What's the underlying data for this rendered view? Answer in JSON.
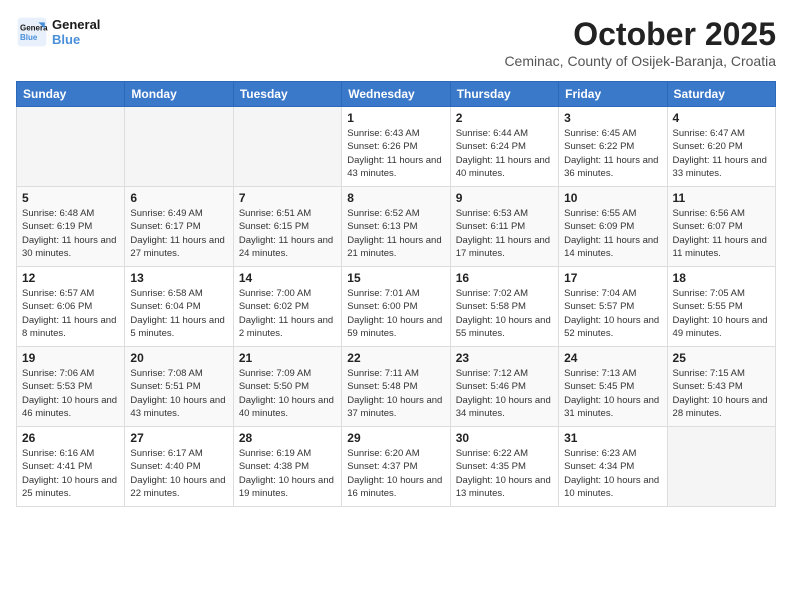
{
  "header": {
    "logo_line1": "General",
    "logo_line2": "Blue",
    "month": "October 2025",
    "location": "Ceminac, County of Osijek-Baranja, Croatia"
  },
  "days_of_week": [
    "Sunday",
    "Monday",
    "Tuesday",
    "Wednesday",
    "Thursday",
    "Friday",
    "Saturday"
  ],
  "weeks": [
    [
      {
        "day": "",
        "info": ""
      },
      {
        "day": "",
        "info": ""
      },
      {
        "day": "",
        "info": ""
      },
      {
        "day": "1",
        "info": "Sunrise: 6:43 AM\nSunset: 6:26 PM\nDaylight: 11 hours and 43 minutes."
      },
      {
        "day": "2",
        "info": "Sunrise: 6:44 AM\nSunset: 6:24 PM\nDaylight: 11 hours and 40 minutes."
      },
      {
        "day": "3",
        "info": "Sunrise: 6:45 AM\nSunset: 6:22 PM\nDaylight: 11 hours and 36 minutes."
      },
      {
        "day": "4",
        "info": "Sunrise: 6:47 AM\nSunset: 6:20 PM\nDaylight: 11 hours and 33 minutes."
      }
    ],
    [
      {
        "day": "5",
        "info": "Sunrise: 6:48 AM\nSunset: 6:19 PM\nDaylight: 11 hours and 30 minutes."
      },
      {
        "day": "6",
        "info": "Sunrise: 6:49 AM\nSunset: 6:17 PM\nDaylight: 11 hours and 27 minutes."
      },
      {
        "day": "7",
        "info": "Sunrise: 6:51 AM\nSunset: 6:15 PM\nDaylight: 11 hours and 24 minutes."
      },
      {
        "day": "8",
        "info": "Sunrise: 6:52 AM\nSunset: 6:13 PM\nDaylight: 11 hours and 21 minutes."
      },
      {
        "day": "9",
        "info": "Sunrise: 6:53 AM\nSunset: 6:11 PM\nDaylight: 11 hours and 17 minutes."
      },
      {
        "day": "10",
        "info": "Sunrise: 6:55 AM\nSunset: 6:09 PM\nDaylight: 11 hours and 14 minutes."
      },
      {
        "day": "11",
        "info": "Sunrise: 6:56 AM\nSunset: 6:07 PM\nDaylight: 11 hours and 11 minutes."
      }
    ],
    [
      {
        "day": "12",
        "info": "Sunrise: 6:57 AM\nSunset: 6:06 PM\nDaylight: 11 hours and 8 minutes."
      },
      {
        "day": "13",
        "info": "Sunrise: 6:58 AM\nSunset: 6:04 PM\nDaylight: 11 hours and 5 minutes."
      },
      {
        "day": "14",
        "info": "Sunrise: 7:00 AM\nSunset: 6:02 PM\nDaylight: 11 hours and 2 minutes."
      },
      {
        "day": "15",
        "info": "Sunrise: 7:01 AM\nSunset: 6:00 PM\nDaylight: 10 hours and 59 minutes."
      },
      {
        "day": "16",
        "info": "Sunrise: 7:02 AM\nSunset: 5:58 PM\nDaylight: 10 hours and 55 minutes."
      },
      {
        "day": "17",
        "info": "Sunrise: 7:04 AM\nSunset: 5:57 PM\nDaylight: 10 hours and 52 minutes."
      },
      {
        "day": "18",
        "info": "Sunrise: 7:05 AM\nSunset: 5:55 PM\nDaylight: 10 hours and 49 minutes."
      }
    ],
    [
      {
        "day": "19",
        "info": "Sunrise: 7:06 AM\nSunset: 5:53 PM\nDaylight: 10 hours and 46 minutes."
      },
      {
        "day": "20",
        "info": "Sunrise: 7:08 AM\nSunset: 5:51 PM\nDaylight: 10 hours and 43 minutes."
      },
      {
        "day": "21",
        "info": "Sunrise: 7:09 AM\nSunset: 5:50 PM\nDaylight: 10 hours and 40 minutes."
      },
      {
        "day": "22",
        "info": "Sunrise: 7:11 AM\nSunset: 5:48 PM\nDaylight: 10 hours and 37 minutes."
      },
      {
        "day": "23",
        "info": "Sunrise: 7:12 AM\nSunset: 5:46 PM\nDaylight: 10 hours and 34 minutes."
      },
      {
        "day": "24",
        "info": "Sunrise: 7:13 AM\nSunset: 5:45 PM\nDaylight: 10 hours and 31 minutes."
      },
      {
        "day": "25",
        "info": "Sunrise: 7:15 AM\nSunset: 5:43 PM\nDaylight: 10 hours and 28 minutes."
      }
    ],
    [
      {
        "day": "26",
        "info": "Sunrise: 6:16 AM\nSunset: 4:41 PM\nDaylight: 10 hours and 25 minutes."
      },
      {
        "day": "27",
        "info": "Sunrise: 6:17 AM\nSunset: 4:40 PM\nDaylight: 10 hours and 22 minutes."
      },
      {
        "day": "28",
        "info": "Sunrise: 6:19 AM\nSunset: 4:38 PM\nDaylight: 10 hours and 19 minutes."
      },
      {
        "day": "29",
        "info": "Sunrise: 6:20 AM\nSunset: 4:37 PM\nDaylight: 10 hours and 16 minutes."
      },
      {
        "day": "30",
        "info": "Sunrise: 6:22 AM\nSunset: 4:35 PM\nDaylight: 10 hours and 13 minutes."
      },
      {
        "day": "31",
        "info": "Sunrise: 6:23 AM\nSunset: 4:34 PM\nDaylight: 10 hours and 10 minutes."
      },
      {
        "day": "",
        "info": ""
      }
    ]
  ]
}
